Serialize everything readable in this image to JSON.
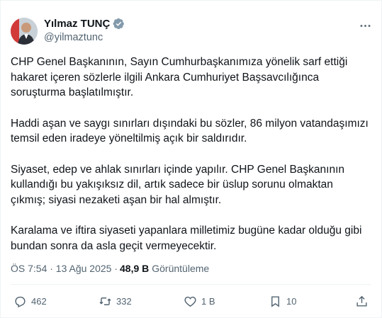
{
  "author": {
    "name": "Yılmaz TUNÇ",
    "handle": "@yilmaztunc",
    "verified_color": "#829aab"
  },
  "tweet": {
    "paragraphs": [
      "CHP Genel Başkanının, Sayın Cumhurbaşkanımıza yönelik sarf ettiği hakaret içeren sözlerle ilgili Ankara Cumhuriyet Başsavcılığınca soruşturma başlatılmıştır.",
      "Haddi aşan ve saygı sınırları dışındaki bu sözler, 86 milyon vatandaşımızı temsil eden iradeye yöneltilmiş açık bir saldırıdır.",
      "Siyaset, edep ve ahlak sınırları içinde yapılır. CHP Genel Başkanının kullandığı bu yakışıksız dil, artık sadece bir üslup sorunu olmaktan çıkmış; siyasi nezaketi aşan bir hal almıştır.",
      "Karalama ve iftira siyaseti yapanlara milletimiz bugüne kadar olduğu gibi bundan sonra da asla geçit vermeyecektir."
    ],
    "timestamp": "ÖS 7:54 · 13 Ağu 2025 · ",
    "views_count": "48,9 B",
    "views_label": "Görüntüleme"
  },
  "actions": {
    "replies": "462",
    "reposts": "332",
    "likes": "1 B",
    "bookmarks": "10"
  },
  "icons": {
    "more": "more-horizontal-icon",
    "reply": "reply-icon",
    "repost": "repost-icon",
    "like": "heart-icon",
    "bookmark": "bookmark-icon",
    "share": "share-icon"
  },
  "colors": {
    "text": "#0f1419",
    "secondary": "#536471"
  }
}
